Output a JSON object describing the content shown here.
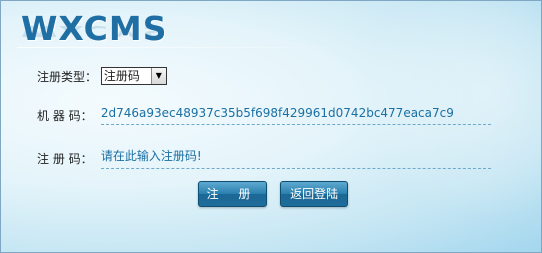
{
  "brand": {
    "logo_text": "WXCMS"
  },
  "form": {
    "type_label": "注册类型：",
    "type_selected": "注册码",
    "machine_label": "机 器 码：",
    "machine_code": "2d746a93ec48937c35b5f698f429961d0742bc477eaca7c9",
    "regcode_label": "注 册 码：",
    "regcode_placeholder": "请在此输入注册码!"
  },
  "buttons": {
    "register_label": "注 册",
    "back_label": "返回登陆"
  },
  "colors": {
    "accent": "#1a6fa3",
    "button": "#1f6d9b",
    "logo": "#1f6fa5"
  }
}
